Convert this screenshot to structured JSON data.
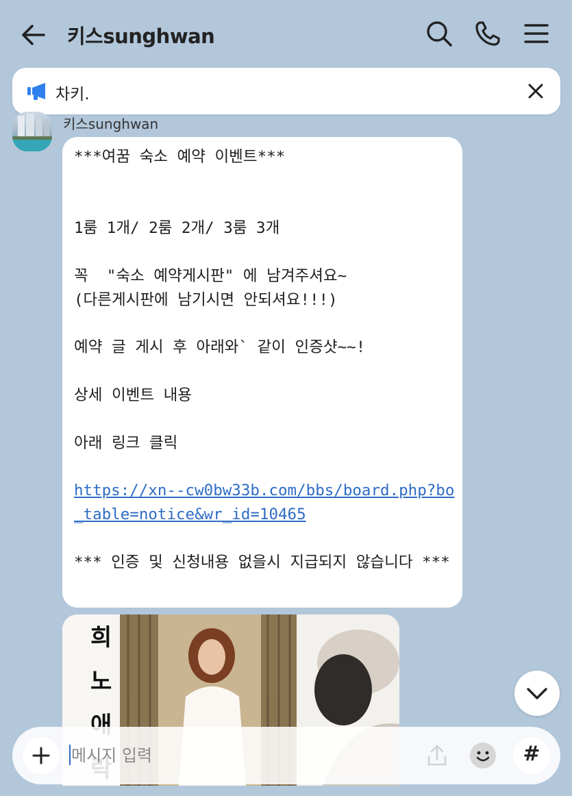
{
  "header": {
    "title": "키스sunghwan"
  },
  "notice": {
    "text": "차키."
  },
  "message": {
    "sender": "키스sunghwan",
    "lines_before_link": "***여꿈 숙소 예약 이벤트***\n\n\n1룸 1개/ 2룸 2개/ 3룸 3개\n\n꼭  \"숙소 예약게시판\" 에 남겨주셔요~\n(다른게시판에 남기시면 안되셔요!!!)\n\n예약 글 게시 후 아래와` 같이 인증샷~~!\n\n상세 이벤트 내용\n\n아래 링크 클릭\n\n",
    "link": "https://xn--cw0bw33b.com/bbs/board.php?bo\n_table=notice&wr_id=10465",
    "lines_after_link": "\n\n*** 인증 및 신청내용 없을시 지급되지 않습니다 ***"
  },
  "photo": {
    "calligraphy": [
      "희",
      "노",
      "애",
      "락"
    ],
    "icon": "share-icon"
  },
  "composer": {
    "placeholder": "메시지 입력",
    "value": "",
    "hash_label": "#"
  },
  "colors": {
    "background": "#b2c7da",
    "link": "#2d6cc5",
    "notice_icon": "#2f80ed"
  }
}
